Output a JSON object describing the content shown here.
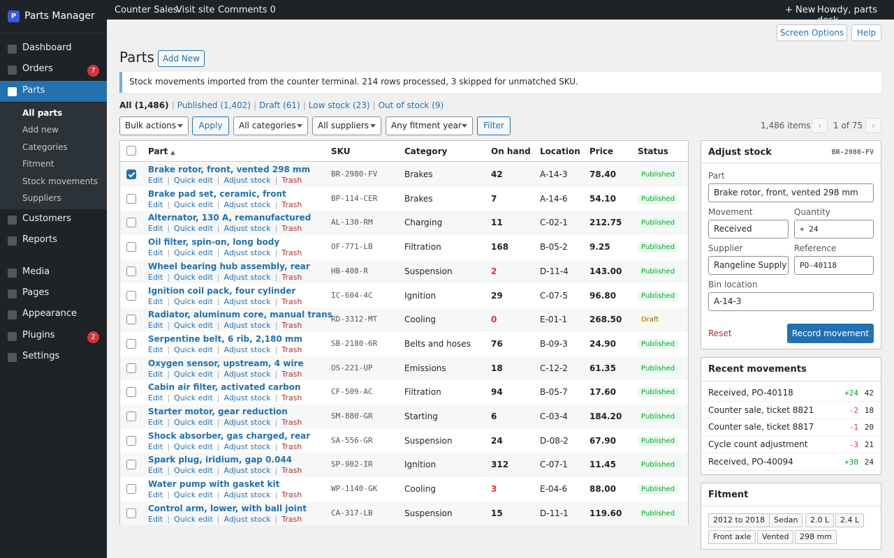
{
  "brand": {
    "name": "Parts Manager",
    "logo_letter": "P"
  },
  "adminbar": {
    "counter_sales": "Counter Sales",
    "visit_site": "Visit site",
    "comments": "Comments 0",
    "new": "+ New",
    "howdy": "Howdy, parts desk"
  },
  "sidebar": {
    "items": [
      {
        "label": "Dashboard"
      },
      {
        "label": "Orders",
        "badge": "7"
      },
      {
        "label": "Parts"
      },
      {
        "label": "Customers"
      },
      {
        "label": "Reports"
      },
      {
        "label": "Media"
      },
      {
        "label": "Pages"
      },
      {
        "label": "Appearance"
      },
      {
        "label": "Plugins",
        "badge": "2"
      },
      {
        "label": "Settings"
      }
    ],
    "submenu": [
      "All parts",
      "Add new",
      "Categories",
      "Fitment",
      "Stock movements",
      "Suppliers"
    ]
  },
  "header": {
    "screen_options": "Screen Options",
    "help": "Help",
    "title": "Parts",
    "add_new": "Add New"
  },
  "notice": "Stock movements imported from the counter terminal. 214 rows processed, 3 skipped for unmatched SKU.",
  "views": {
    "all": "All (1,486)",
    "published": "Published (1,402)",
    "draft": "Draft (61)",
    "low": "Low stock (23)",
    "out": "Out of stock (9)"
  },
  "filters": {
    "bulk": "Bulk actions",
    "apply": "Apply",
    "categories": "All categories",
    "suppliers": "All suppliers",
    "year": "Any fitment year",
    "filter": "Filter"
  },
  "pagination": {
    "items": "1,486 items",
    "prev": "‹",
    "page": "1 of 75",
    "next": "›"
  },
  "columns": {
    "part": "Part",
    "sort_arrow": "▲",
    "sku": "SKU",
    "category": "Category",
    "on_hand": "On hand",
    "location": "Location",
    "price": "Price",
    "status": "Status"
  },
  "row_actions": {
    "edit": "Edit",
    "quick_edit": "Quick edit",
    "adjust": "Adjust stock",
    "trash": "Trash"
  },
  "rows": [
    {
      "title": "Brake rotor, front, vented 298 mm",
      "sku": "BR-2980-FV",
      "category": "Brakes",
      "on_hand": "42",
      "location": "A-14-3",
      "price": "78.40",
      "status": "Published"
    },
    {
      "title": "Brake pad set, ceramic, front",
      "sku": "BP-114-CER",
      "category": "Brakes",
      "on_hand": "7",
      "location": "A-14-6",
      "price": "54.10",
      "status": "Published"
    },
    {
      "title": "Alternator, 130 A, remanufactured",
      "sku": "AL-130-RM",
      "category": "Charging",
      "on_hand": "11",
      "location": "C-02-1",
      "price": "212.75",
      "status": "Published"
    },
    {
      "title": "Oil filter, spin-on, long body",
      "sku": "OF-771-LB",
      "category": "Filtration",
      "on_hand": "168",
      "location": "B-05-2",
      "price": "9.25",
      "status": "Published"
    },
    {
      "title": "Wheel bearing hub assembly, rear",
      "sku": "HB-408-R",
      "category": "Suspension",
      "on_hand": "2",
      "location": "D-11-4",
      "price": "143.00",
      "status": "Published"
    },
    {
      "title": "Ignition coil pack, four cylinder",
      "sku": "IC-604-4C",
      "category": "Ignition",
      "on_hand": "29",
      "location": "C-07-5",
      "price": "96.80",
      "status": "Published"
    },
    {
      "title": "Radiator, aluminum core, manual trans",
      "sku": "RD-3312-MT",
      "category": "Cooling",
      "on_hand": "0",
      "location": "E-01-1",
      "price": "268.50",
      "status": "Draft"
    },
    {
      "title": "Serpentine belt, 6 rib, 2,180 mm",
      "sku": "SB-2180-6R",
      "category": "Belts and hoses",
      "on_hand": "76",
      "location": "B-09-3",
      "price": "24.90",
      "status": "Published"
    },
    {
      "title": "Oxygen sensor, upstream, 4 wire",
      "sku": "OS-221-UP",
      "category": "Emissions",
      "on_hand": "18",
      "location": "C-12-2",
      "price": "61.35",
      "status": "Published"
    },
    {
      "title": "Cabin air filter, activated carbon",
      "sku": "CF-509-AC",
      "category": "Filtration",
      "on_hand": "94",
      "location": "B-05-7",
      "price": "17.60",
      "status": "Published"
    },
    {
      "title": "Starter motor, gear reduction",
      "sku": "SM-880-GR",
      "category": "Starting",
      "on_hand": "6",
      "location": "C-03-4",
      "price": "184.20",
      "status": "Published"
    },
    {
      "title": "Shock absorber, gas charged, rear",
      "sku": "SA-556-GR",
      "category": "Suspension",
      "on_hand": "24",
      "location": "D-08-2",
      "price": "67.90",
      "status": "Published"
    },
    {
      "title": "Spark plug, iridium, gap 0.044",
      "sku": "SP-902-IR",
      "category": "Ignition",
      "on_hand": "312",
      "location": "C-07-1",
      "price": "11.45",
      "status": "Published"
    },
    {
      "title": "Water pump with gasket kit",
      "sku": "WP-1140-GK",
      "category": "Cooling",
      "on_hand": "3",
      "location": "E-04-6",
      "price": "88.00",
      "status": "Published"
    },
    {
      "title": "Control arm, lower, with ball joint",
      "sku": "CA-317-LB",
      "category": "Suspension",
      "on_hand": "15",
      "location": "D-11-1",
      "price": "119.60",
      "status": "Published"
    }
  ],
  "adjust": {
    "heading": "Adjust stock",
    "sku": "BR-2980-FV",
    "part_label": "Part",
    "part_value": "Brake rotor, front, vented 298 mm",
    "movement_label": "Movement",
    "movement_value": "Received",
    "quantity_label": "Quantity",
    "quantity_value": "+ 24",
    "supplier_label": "Supplier",
    "supplier_value": "Rangeline Supply",
    "reference_label": "Reference",
    "reference_value": "PO-40118",
    "bin_label": "Bin location",
    "bin_value": "A-14-3",
    "reset": "Reset",
    "record": "Record movement"
  },
  "recent": {
    "heading": "Recent movements",
    "items": [
      {
        "text": "Received, PO-40118",
        "delta": "+24",
        "balance": "42"
      },
      {
        "text": "Counter sale, ticket 8821",
        "delta": "-2",
        "balance": "18"
      },
      {
        "text": "Counter sale, ticket 8817",
        "delta": "-1",
        "balance": "20"
      },
      {
        "text": "Cycle count adjustment",
        "delta": "-3",
        "balance": "21"
      },
      {
        "text": "Received, PO-40094",
        "delta": "+30",
        "balance": "24"
      }
    ]
  },
  "fitment": {
    "heading": "Fitment",
    "tags": [
      "2012 to 2018",
      "Sedan",
      "2.0 L",
      "2.4 L",
      "Front axle",
      "Vented",
      "298 mm"
    ]
  },
  "colors": {
    "accent": "#2271b1",
    "sidebar": "#1d2327",
    "danger": "#d63638",
    "success": "#00a32a"
  }
}
